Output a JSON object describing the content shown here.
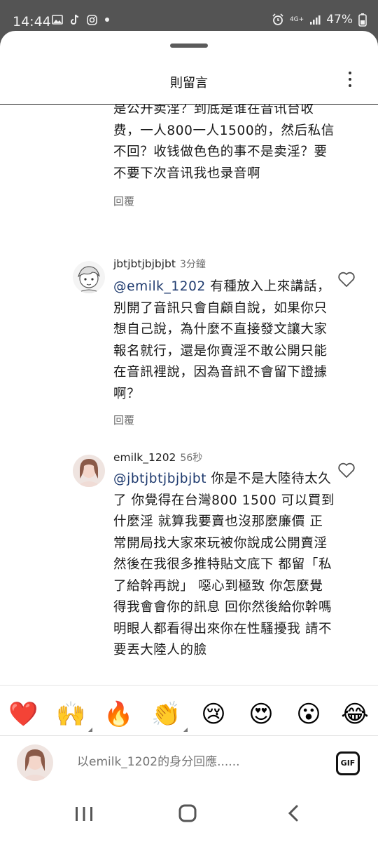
{
  "status_bar": {
    "time": "14:44",
    "battery": "47%",
    "network": "4G+",
    "left_icons": [
      "gallery-icon",
      "tiktok-icon",
      "instagram-icon",
      "dot-icon"
    ],
    "right_icons": [
      "alarm-icon",
      "network-icon",
      "signal-icon",
      "battery-icon"
    ]
  },
  "header": {
    "title": "則留言"
  },
  "comments": [
    {
      "id": "partial",
      "text": "是公开卖淫？到底是谁在音讯台收费，一人800一人1500的，然后私信不回？收钱做色色的事不是卖淫？要不要下次音讯我也录音啊",
      "reply_label": "回覆"
    },
    {
      "id": "c1",
      "username": "jbtjbtjbjbjbt",
      "time": "3分鐘",
      "mention": "@emilk_1202",
      "text": " 有種放入上來講話，別開了音訊只會自顧自說，如果你只想自己說，為什麼不直接發文讓大家報名就行，還是你賣淫不敢公開只能在音訊裡說，因為音訊不會留下證據啊？",
      "reply_label": "回覆"
    },
    {
      "id": "c2",
      "username": "emilk_1202",
      "time": "56秒",
      "mention": "@jbtjbtjbjbjbt",
      "text": " 你是不是大陸待太久了 你覺得在台灣800 1500 可以買到什麼淫 就算我要賣也沒那麼廉價 正常開局找大家來玩被你說成公開賣淫 然後在我很多推特貼文底下 都留「私了給幹再說」 噁心到極致 你怎麼覺得我會會你的訊息 回你然後給你幹嗎 明眼人都看得出來你在性騷擾我 請不要丟大陸人的臉",
      "reply_label": "回覆"
    }
  ],
  "emoji_bar": [
    {
      "name": "heart-emoji",
      "glyph": "❤️"
    },
    {
      "name": "raised-hands-emoji",
      "glyph": "🙌"
    },
    {
      "name": "fire-emoji",
      "glyph": "🔥"
    },
    {
      "name": "clapping-emoji",
      "glyph": "👏"
    },
    {
      "name": "crying-face-emoji",
      "glyph": "😢"
    },
    {
      "name": "heart-eyes-emoji",
      "glyph": "😍"
    },
    {
      "name": "surprised-face-emoji",
      "glyph": "😮"
    },
    {
      "name": "tears-of-joy-emoji",
      "glyph": "😂"
    }
  ],
  "input": {
    "placeholder": "以emilk_1202的身分回應......",
    "gif_label": "GIF"
  },
  "colors": {
    "mention": "#1e3a6e",
    "status_bar_bg": "#545454"
  }
}
